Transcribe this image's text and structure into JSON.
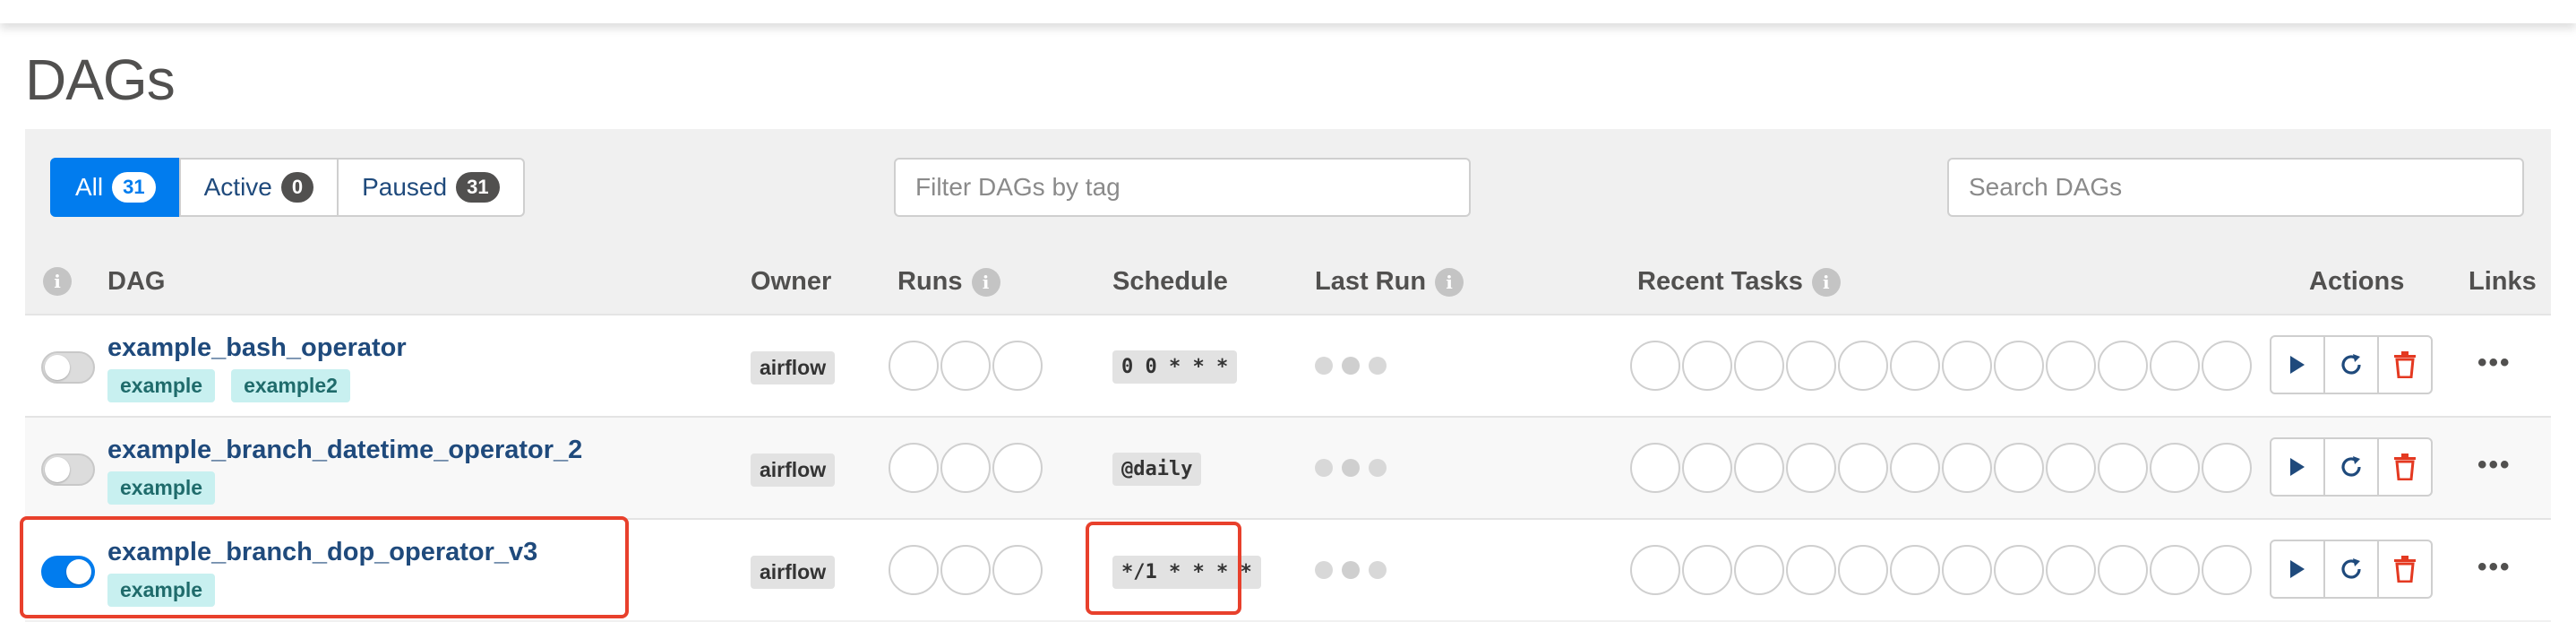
{
  "page": {
    "title": "DAGs"
  },
  "filters": {
    "all": {
      "label": "All",
      "count": "31"
    },
    "active": {
      "label": "Active",
      "count": "0"
    },
    "paused": {
      "label": "Paused",
      "count": "31"
    }
  },
  "tag_filter": {
    "placeholder": "Filter DAGs by tag",
    "value": ""
  },
  "search": {
    "placeholder": "Search DAGs",
    "value": ""
  },
  "columns": {
    "dag": "DAG",
    "owner": "Owner",
    "runs": "Runs",
    "schedule": "Schedule",
    "last_run": "Last Run",
    "recent_tasks": "Recent Tasks",
    "actions": "Actions",
    "links": "Links"
  },
  "rows": [
    {
      "dag_id": "example_bash_operator",
      "tags": [
        "example",
        "example2"
      ],
      "owner": "airflow",
      "schedule": "0 0 * * *",
      "active": false,
      "highlighted": false
    },
    {
      "dag_id": "example_branch_datetime_operator_2",
      "tags": [
        "example"
      ],
      "owner": "airflow",
      "schedule": "@daily",
      "active": false,
      "highlighted": false
    },
    {
      "dag_id": "example_branch_dop_operator_v3",
      "tags": [
        "example"
      ],
      "owner": "airflow",
      "schedule": "*/1 * * * *",
      "active": true,
      "highlighted": true
    }
  ],
  "icons": {
    "info": "info-icon",
    "trigger": "play-icon",
    "refresh": "refresh-icon",
    "delete": "trash-icon",
    "links": "more-dots-icon"
  },
  "colors": {
    "accent": "#017cee",
    "link": "#1f4a7c",
    "tag_bg": "#c8f0f0",
    "delete": "#e43921",
    "highlight": "#e8402c"
  }
}
